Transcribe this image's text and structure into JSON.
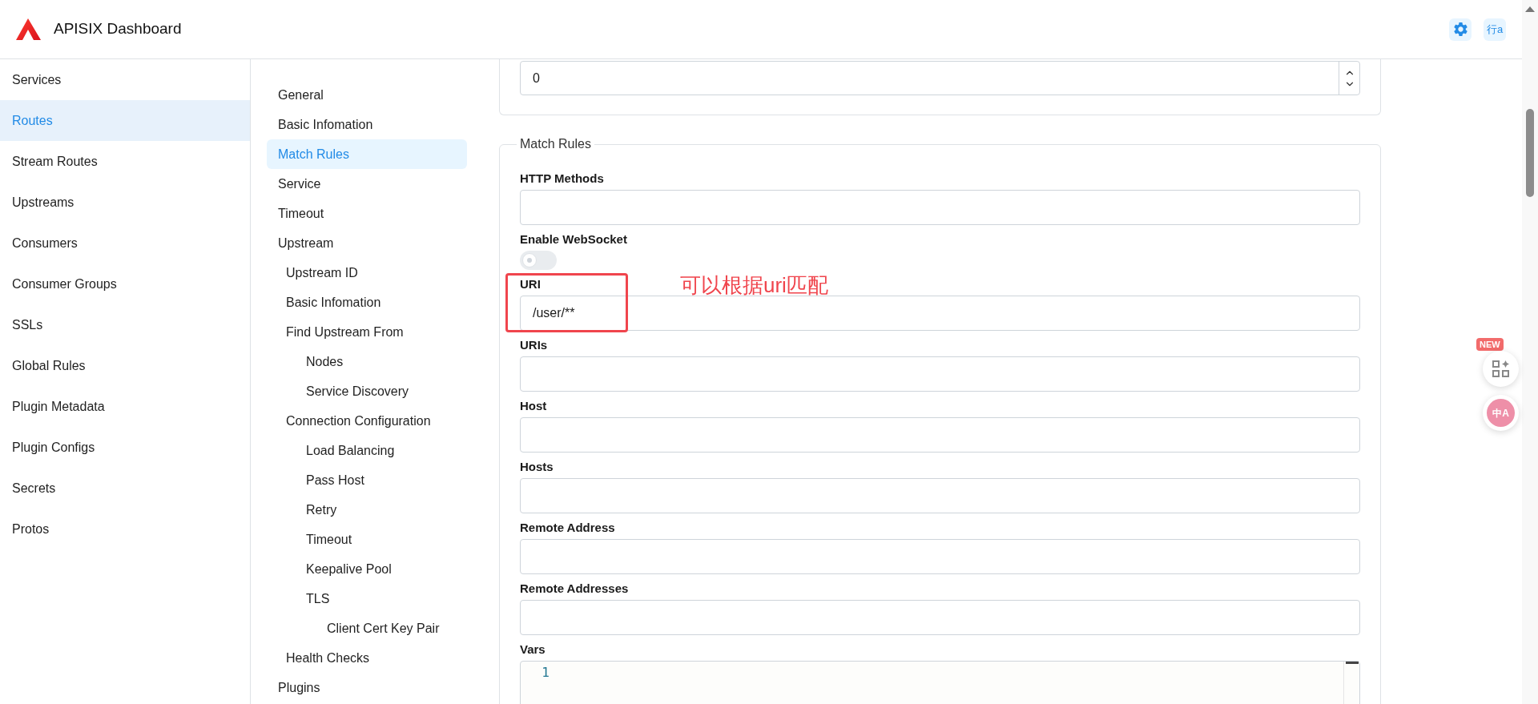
{
  "header": {
    "title": "APISIX Dashboard",
    "language_glyph": "行a"
  },
  "sidebar": {
    "items": [
      {
        "label": "Services",
        "selected": false
      },
      {
        "label": "Routes",
        "selected": true
      },
      {
        "label": "Stream Routes",
        "selected": false
      },
      {
        "label": "Upstreams",
        "selected": false
      },
      {
        "label": "Consumers",
        "selected": false
      },
      {
        "label": "Consumer Groups",
        "selected": false
      },
      {
        "label": "SSLs",
        "selected": false
      },
      {
        "label": "Global Rules",
        "selected": false
      },
      {
        "label": "Plugin Metadata",
        "selected": false
      },
      {
        "label": "Plugin Configs",
        "selected": false
      },
      {
        "label": "Secrets",
        "selected": false
      },
      {
        "label": "Protos",
        "selected": false
      }
    ]
  },
  "toc": {
    "items": [
      {
        "label": "General",
        "selected": false
      },
      {
        "label": "Basic Infomation",
        "selected": false
      },
      {
        "label": "Match Rules",
        "selected": true
      },
      {
        "label": "Service",
        "selected": false
      },
      {
        "label": "Timeout",
        "selected": false
      },
      {
        "label": "Upstream",
        "selected": false,
        "children": [
          {
            "label": "Upstream ID",
            "selected": false
          },
          {
            "label": "Basic Infomation",
            "selected": false
          },
          {
            "label": "Find Upstream From",
            "selected": false,
            "children": [
              {
                "label": "Nodes",
                "selected": false
              },
              {
                "label": "Service Discovery",
                "selected": false
              }
            ]
          },
          {
            "label": "Connection Configuration",
            "selected": false,
            "children": [
              {
                "label": "Load Balancing",
                "selected": false
              },
              {
                "label": "Pass Host",
                "selected": false
              },
              {
                "label": "Retry",
                "selected": false
              },
              {
                "label": "Timeout",
                "selected": false
              },
              {
                "label": "Keepalive Pool",
                "selected": false
              },
              {
                "label": "TLS",
                "selected": false,
                "children": [
                  {
                    "label": "Client Cert Key Pair",
                    "selected": false
                  }
                ]
              }
            ]
          },
          {
            "label": "Health Checks",
            "selected": false
          }
        ]
      },
      {
        "label": "Plugins",
        "selected": false
      }
    ]
  },
  "previous_field": {
    "value": "0"
  },
  "match_rules": {
    "legend": "Match Rules",
    "fields": [
      {
        "kind": "input",
        "label": "HTTP Methods"
      },
      {
        "kind": "switch",
        "label": "Enable WebSocket",
        "on": false
      },
      {
        "kind": "input",
        "label": "URI",
        "value": "/user/**",
        "annotation": "可以根据uri匹配"
      },
      {
        "kind": "input",
        "label": "URIs"
      },
      {
        "kind": "input",
        "label": "Host"
      },
      {
        "kind": "input",
        "label": "Hosts"
      },
      {
        "kind": "input",
        "label": "Remote Address"
      },
      {
        "kind": "input",
        "label": "Remote Addresses"
      },
      {
        "kind": "code",
        "label": "Vars",
        "line_numbers": [
          "1"
        ]
      }
    ]
  },
  "floating": {
    "badge": "NEW",
    "translate_glyph": "中A"
  }
}
